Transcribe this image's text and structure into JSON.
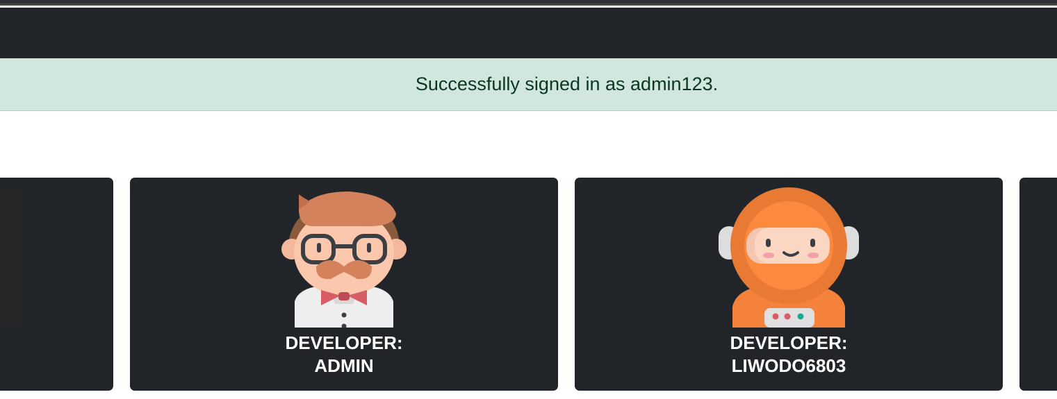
{
  "alert": {
    "message": "Successfully signed in as admin123."
  },
  "cards": [
    {
      "role": "DEVELOPER:",
      "username": "ADMIN",
      "avatar_icon": "developer-avatar-icon"
    },
    {
      "role": "DEVELOPER:",
      "username": "LIWODO6803",
      "avatar_icon": "astronaut-avatar-icon"
    }
  ],
  "colors": {
    "navbar": "#212529",
    "alert_bg": "#d1e7dd",
    "alert_text": "#0a3622",
    "card_bg": "#212529"
  }
}
